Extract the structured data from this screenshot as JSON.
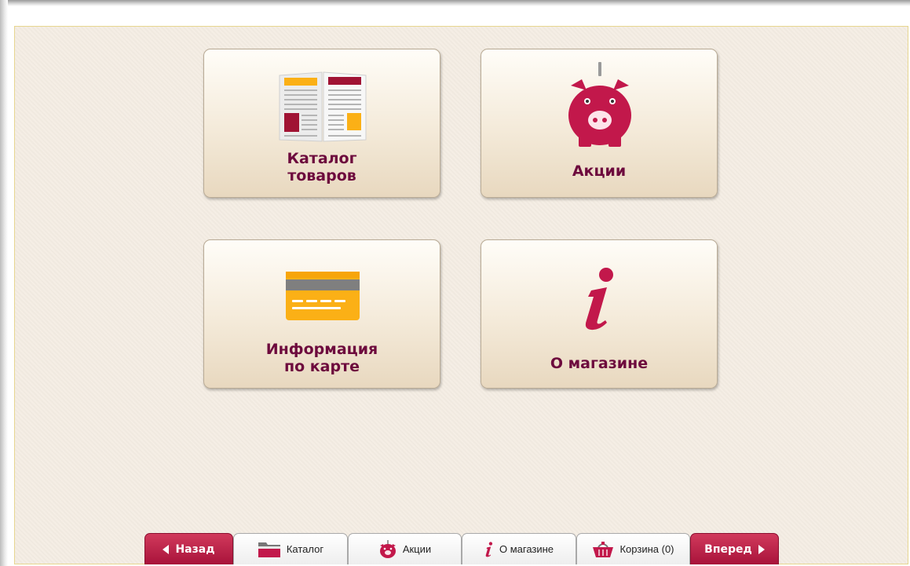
{
  "tiles": [
    {
      "label": "Каталог\nтоваров",
      "icon": "catalog-book-icon"
    },
    {
      "label": "Акции",
      "icon": "piggy-bank-icon"
    },
    {
      "label": "Информация\nпо карте",
      "icon": "credit-card-icon"
    },
    {
      "label": "О магазине",
      "icon": "info-icon"
    }
  ],
  "nav": {
    "back_label": "Назад",
    "catalog_label": "Каталог",
    "promos_label": "Акции",
    "about_label": "О магазине",
    "cart_label": "Корзина (0)",
    "forward_label": "Вперед"
  },
  "colors": {
    "accent": "#c2184b",
    "label": "#6d0a3d",
    "background": "#f4ede3",
    "card_yellow": "#fbb016",
    "card_gray": "#7f7f7f"
  }
}
